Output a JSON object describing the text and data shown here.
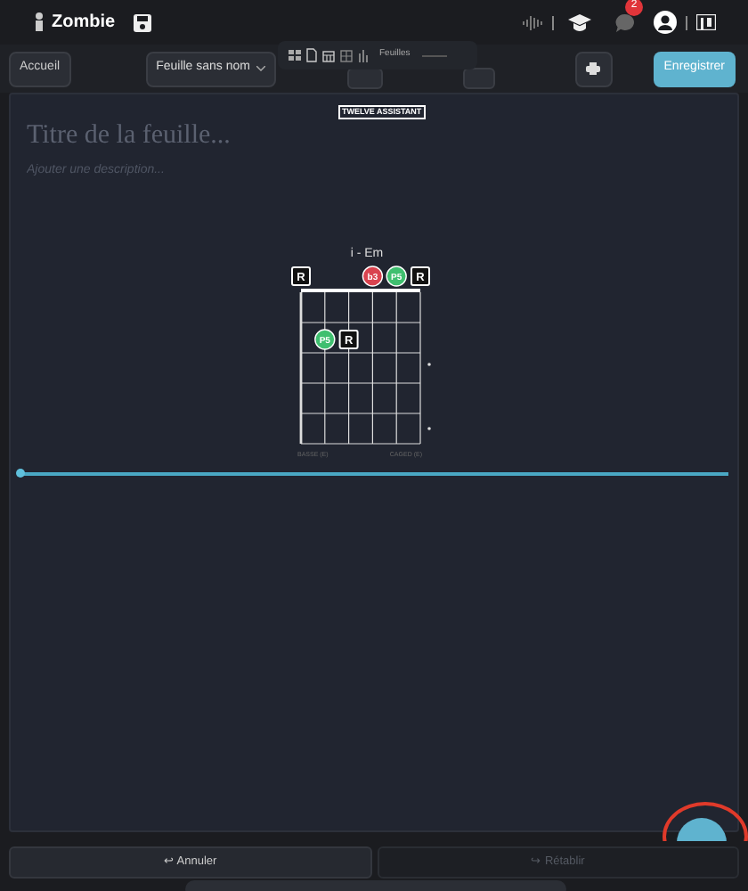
{
  "header": {
    "project": "Zombie",
    "notification_count": "2"
  },
  "toolbar": {
    "home": "Accueil",
    "sheet_menu": "Feuille sans nom",
    "sheets_label": "Feuilles",
    "save": "Enregistrer"
  },
  "sheet": {
    "title_placeholder": "Titre de la feuille...",
    "description_placeholder": "Ajouter une description...",
    "badge": "TWELVE ASSISTANT"
  },
  "chord": {
    "title": "i - Em",
    "bass_label": "BASSE (E)",
    "caged_label": "CAGED (E)",
    "rows": [
      [
        {
          "kind": "root",
          "label": "R"
        },
        null,
        null,
        {
          "kind": "interval",
          "label": "b3",
          "color": "#d9434f"
        },
        {
          "kind": "interval",
          "label": "P5",
          "color": "#3fbf6f"
        },
        {
          "kind": "root",
          "label": "R"
        }
      ],
      [
        null,
        null,
        null,
        null,
        null,
        null
      ],
      [
        null,
        {
          "kind": "interval",
          "label": "P5",
          "color": "#3fbf6f"
        },
        {
          "kind": "root",
          "label": "R"
        },
        null,
        null,
        null
      ]
    ]
  },
  "timeline": {
    "level": 0
  },
  "footer": {
    "undo": "↩ Annuler",
    "redo": "↪ Rétablir",
    "undo_disabled": false,
    "redo_disabled": true
  }
}
